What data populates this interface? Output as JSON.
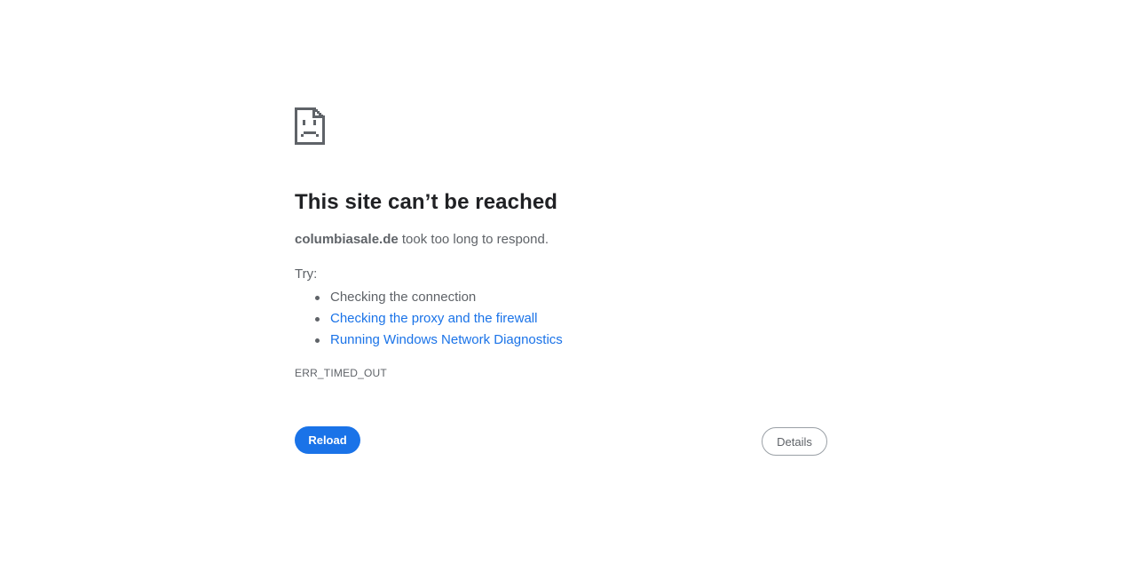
{
  "error": {
    "icon": "sad-document-icon",
    "title": "This site can’t be reached",
    "host": "columbiasale.de",
    "message": " took too long to respond.",
    "try_label": "Try:",
    "suggestions": [
      {
        "label": "Checking the connection",
        "is_link": false
      },
      {
        "label": "Checking the proxy and the firewall",
        "is_link": true
      },
      {
        "label": "Running Windows Network Diagnostics",
        "is_link": true
      }
    ],
    "code": "ERR_TIMED_OUT"
  },
  "buttons": {
    "reload_label": "Reload",
    "details_label": "Details"
  },
  "colors": {
    "accent": "#1a73e8",
    "text_primary": "#202124",
    "text_secondary": "#5f6368",
    "border": "#9aa0a6",
    "background": "#ffffff"
  }
}
